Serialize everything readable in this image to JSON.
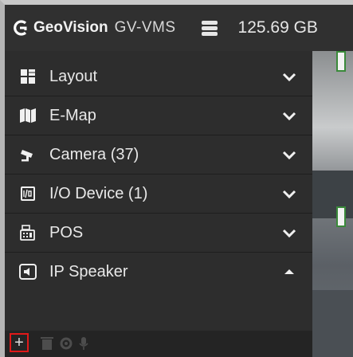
{
  "header": {
    "brand_name": "GeoVision",
    "product": "GV-VMS",
    "storage": "125.69 GB",
    "icons": [
      "geovision-logo-icon",
      "storage-database-icon"
    ]
  },
  "menu": {
    "items": [
      {
        "label": "Layout",
        "icon": "layout-grid-icon",
        "expanded": false
      },
      {
        "label": "E-Map",
        "icon": "map-icon",
        "expanded": false
      },
      {
        "label": "Camera (37)",
        "icon": "camera-icon",
        "expanded": false
      },
      {
        "label": "I/O Device (1)",
        "icon": "io-device-icon",
        "expanded": false
      },
      {
        "label": "POS",
        "icon": "pos-register-icon",
        "expanded": false
      },
      {
        "label": "IP Speaker",
        "icon": "ip-speaker-icon",
        "expanded": true
      }
    ]
  },
  "toolbar": {
    "add_label": "+",
    "icons": [
      "add-icon",
      "trash-icon",
      "gear-icon",
      "microphone-icon"
    ]
  },
  "colors": {
    "background": "#2c2c2c",
    "highlight_border": "#e01919"
  }
}
